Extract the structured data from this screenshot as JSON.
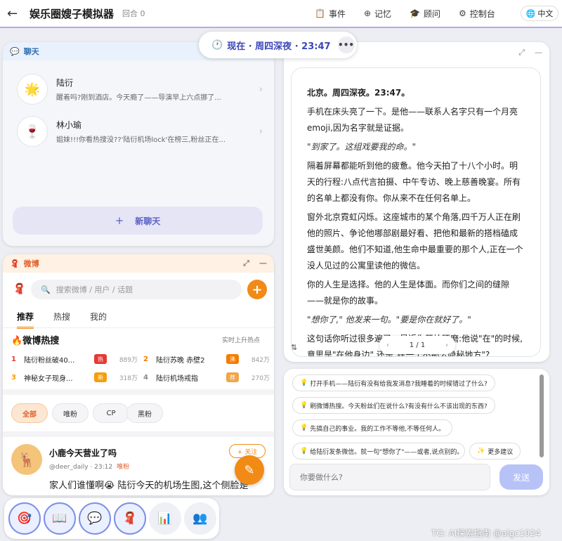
{
  "header": {
    "back_icon": "←",
    "title": "娱乐圈嫂子模拟器",
    "round": "回合 0",
    "nav": [
      {
        "icon": "📋",
        "label": "事件"
      },
      {
        "icon": "⊕",
        "label": "记忆"
      },
      {
        "icon": "🎓",
        "label": "顾问"
      },
      {
        "icon": "⚙",
        "label": "控制台"
      }
    ],
    "lang_icon": "🌐",
    "lang": "中文"
  },
  "time": {
    "icon": "🕐",
    "text": "现在 · 周四深夜 · 23:47",
    "more": "•••"
  },
  "chat": {
    "icon": "💬",
    "title": "聊天",
    "items": [
      {
        "avatar": "🌟",
        "name": "陆衍",
        "preview": "醒着吗?刚到酒店。今天瘾了——导演早上六点挪了..."
      },
      {
        "avatar": "🍷",
        "name": "林小瑜",
        "preview": "姐妹!!!你看热搜没??'陆衍机场lock'在榜三,粉丝正在..."
      }
    ],
    "new_chat_plus": "+",
    "new_chat": "新聊天"
  },
  "story": {
    "paragraphs": [
      {
        "style": "head",
        "text": "北京。周四深夜。23:47。"
      },
      {
        "style": "normal",
        "text": "手机在床头亮了一下。是他——联系人名字只有一个月亮emoji,因为名字就是证据。"
      },
      {
        "style": "quote",
        "text": "\"到家了。这组戏要我的命。\""
      },
      {
        "style": "normal",
        "text": "隔着屏幕都能听到他的疲惫。他今天拍了十八个小时。明天的行程:八点代言拍摄、中午专访、晚上慈善晚宴。所有的名单上都没有你。你从来不在任何名单上。"
      },
      {
        "style": "normal",
        "text": "窗外北京霓虹闪烁。这座城市的某个角落,四千万人正在刷他的照片、争论他哪部剧最好看、把他和最新的搭档磕成盛世美颜。他们不知道,他生命中最重要的那个人,正在一个没人见过的公寓里读他的微信。"
      },
      {
        "style": "normal",
        "text": "你的人生是选择。他的人生是体面。而你们之间的缝隙——就是你的故事。"
      },
      {
        "style": "quote",
        "text": "\"想你了,\" 他发来一句。\"要是你在就好了。\""
      },
      {
        "style": "normal",
        "text": "这句话你听过很多遍了。最近你开始琢磨:他说\"在\"的时候,意思是\"在他身边\",还是\"在一个不那么隐秘地方\"?"
      }
    ],
    "pager": {
      "prev": "‹",
      "text": "1 / 1",
      "next": "›"
    },
    "sort_icon": "⇅",
    "expand_icon": "⤢",
    "minimize_icon": "—"
  },
  "actions": {
    "suggestions": [
      "打开手机——陆衍有没有给我发消息?我睡着的时候错过了什么?",
      "刷微博热搜。今天粉丝们在说什么?有没有什么不该出现的东西?",
      "先搞自己的事业。我的工作不等他,不等任何人。",
      "给陆衍发条微信。就一句\"想你了\"——或者,说点别的。"
    ],
    "bulb_icon": "💡",
    "more_icon": "✨",
    "more": "更多建议",
    "input_placeholder": "你要做什么?",
    "send": "发送"
  },
  "weibo": {
    "icon": "🧣",
    "title": "微博",
    "search_icon": "🔍",
    "search_placeholder": "搜索微博 / 用户 / 话题",
    "plus": "+",
    "tabs": [
      "推荐",
      "热搜",
      "我的"
    ],
    "hot_icon": "🔥",
    "hot_title": "微博热搜",
    "hot_sub": "实时上升热点",
    "hot": [
      {
        "rank": "1",
        "text": "陆衍粉丝破40...",
        "tag": "热",
        "tag_color": "#e53935",
        "count": "889万"
      },
      {
        "rank": "2",
        "text": "陆衍苏晚 赤壁2",
        "tag": "沸",
        "tag_color": "#f57c00",
        "count": "842万"
      },
      {
        "rank": "3",
        "text": "神秘女子现身...",
        "tag": "新",
        "tag_color": "#f59e0b",
        "count": "318万"
      },
      {
        "rank": "4",
        "text": "陆衍机场戒指",
        "tag": "荐",
        "tag_color": "#f0a64a",
        "count": "270万"
      }
    ],
    "filters": [
      "全部",
      "唯粉",
      "CP",
      "黑粉"
    ],
    "post": {
      "avatar": "🦌",
      "name": "小鹿今天营业了吗",
      "handle": "@deer_daily · 23:12",
      "tag": "唯粉",
      "follow": "+ 关注",
      "body": "家人们谁懂啊😭 陆衍今天的机场生图,这个侧脸是",
      "fab_icon": "✎"
    }
  },
  "dock": [
    {
      "icon": "🎯",
      "name": "goals"
    },
    {
      "icon": "📖",
      "name": "story"
    },
    {
      "icon": "💬",
      "name": "chat"
    },
    {
      "icon": "🧣",
      "name": "weibo"
    },
    {
      "icon": "📊",
      "name": "stats"
    },
    {
      "icon": "👥",
      "name": "people"
    }
  ],
  "watermark": "TG: AI探索指南 @aigc1024"
}
